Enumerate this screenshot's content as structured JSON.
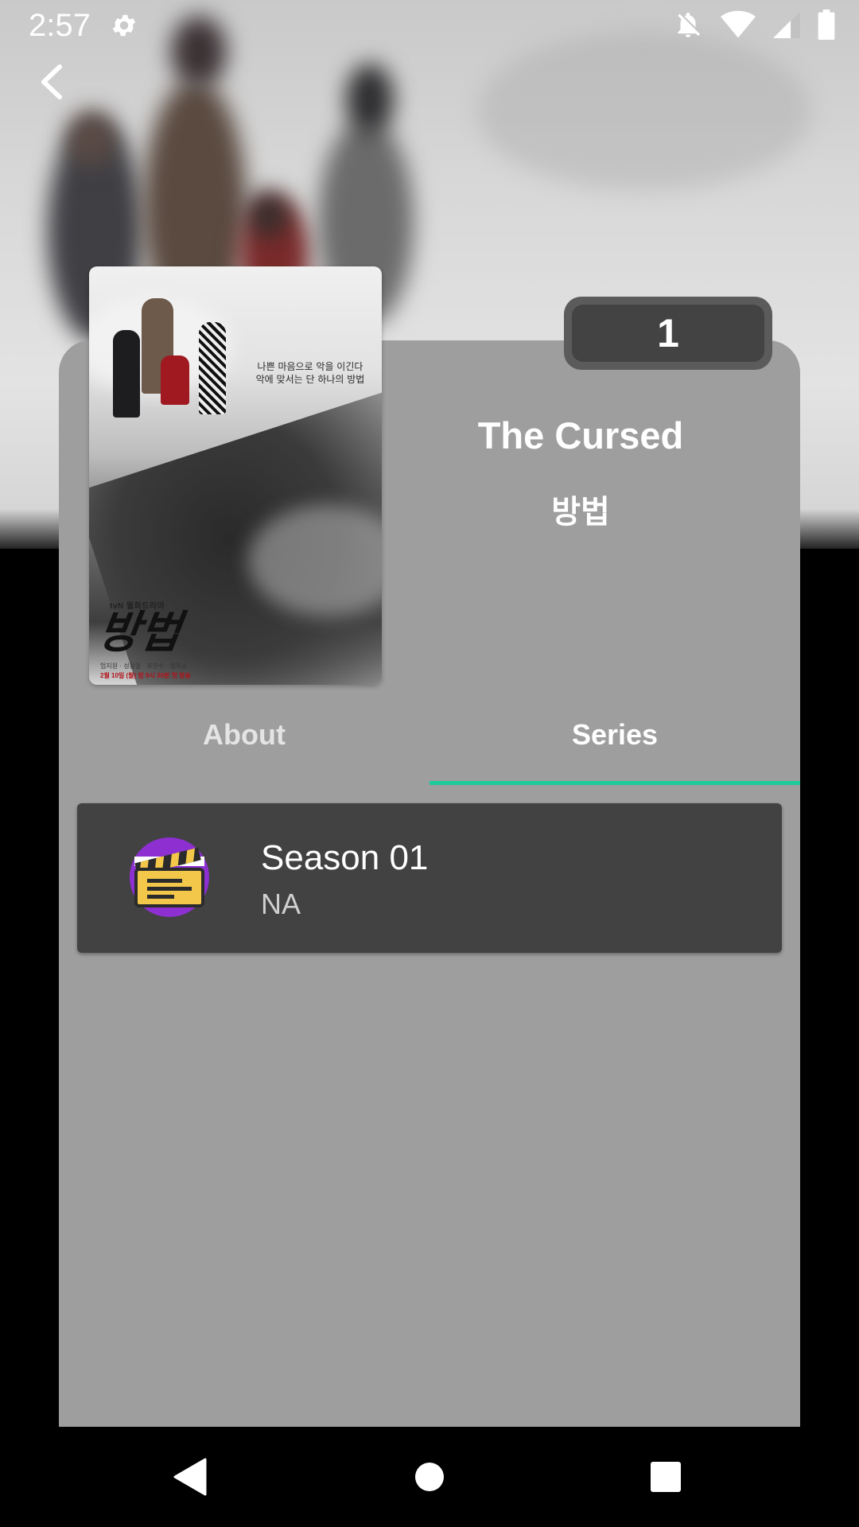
{
  "status_bar": {
    "time": "2:57",
    "icons": [
      "settings-icon",
      "notifications-off-icon",
      "wifi-icon",
      "signal-icon",
      "battery-icon"
    ]
  },
  "header": {
    "back_icon": "chevron-left-icon"
  },
  "badge": {
    "season_count": "1"
  },
  "poster": {
    "tagline_line1": "나쁜 마음으로 악을 이긴다",
    "tagline_line2": "악에 맞서는 단 하나의 방법",
    "channel": "tvN 월화드라마",
    "title": "방법",
    "credits": "엄지원 · 성동일 · 조민수 · 정지소",
    "date": "2월 10일 (월) 밤 9시 30분 첫 방송"
  },
  "title": {
    "english": "The Cursed",
    "korean": "방법"
  },
  "tabs": [
    {
      "label": "About",
      "selected": false
    },
    {
      "label": "Series",
      "selected": true
    }
  ],
  "seasons": [
    {
      "name": "Season 01",
      "subtitle": "NA",
      "icon": "clapperboard-icon"
    }
  ],
  "colors": {
    "card": "#9e9e9e",
    "row": "#424242",
    "tab_indicator": "#1ec99a",
    "badge": "#434343"
  },
  "nav_bar": {
    "icons": [
      "back-triangle-icon",
      "home-circle-icon",
      "recents-square-icon"
    ]
  }
}
